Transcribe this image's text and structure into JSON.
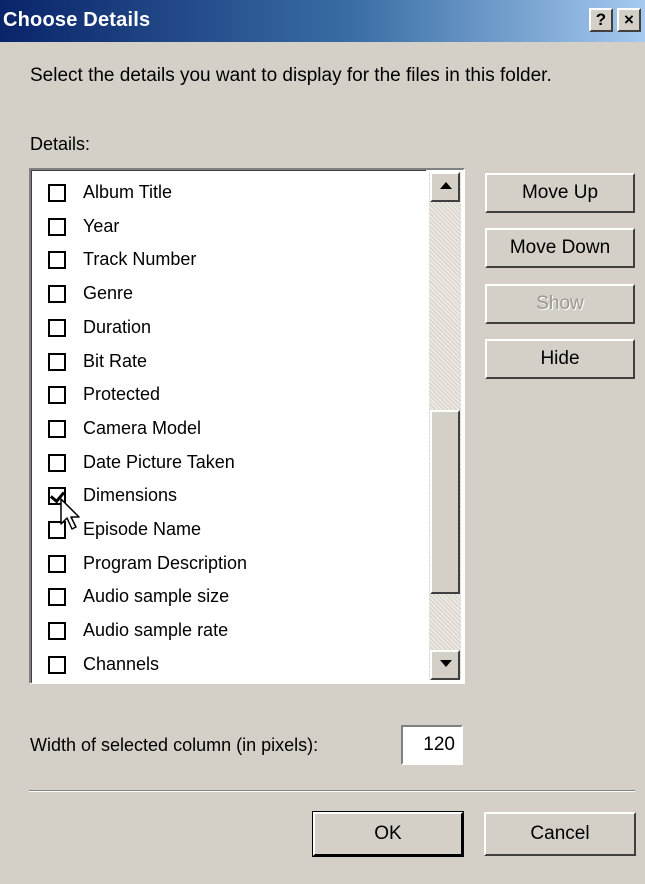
{
  "window": {
    "title": "Choose Details",
    "help_label": "?",
    "close_label": "×"
  },
  "instructions": "Select the details you want to display for the files in this folder.",
  "details_label": "Details:",
  "details": [
    {
      "label": "Album Title",
      "checked": false
    },
    {
      "label": "Year",
      "checked": false
    },
    {
      "label": "Track Number",
      "checked": false
    },
    {
      "label": "Genre",
      "checked": false
    },
    {
      "label": "Duration",
      "checked": false
    },
    {
      "label": "Bit Rate",
      "checked": false
    },
    {
      "label": "Protected",
      "checked": false
    },
    {
      "label": "Camera Model",
      "checked": false
    },
    {
      "label": "Date Picture Taken",
      "checked": false
    },
    {
      "label": "Dimensions",
      "checked": true
    },
    {
      "label": "Episode Name",
      "checked": false
    },
    {
      "label": "Program Description",
      "checked": false
    },
    {
      "label": "Audio sample size",
      "checked": false
    },
    {
      "label": "Audio sample rate",
      "checked": false
    },
    {
      "label": "Channels",
      "checked": false
    }
  ],
  "buttons": {
    "move_up": "Move Up",
    "move_down": "Move Down",
    "show": "Show",
    "hide": "Hide",
    "ok": "OK",
    "cancel": "Cancel"
  },
  "width_label": "Width of selected column (in pixels):",
  "width_value": "120",
  "colors": {
    "titlebar_start": "#0a246a",
    "titlebar_end": "#a6caf0",
    "dialog_face": "#d4d0c8"
  }
}
